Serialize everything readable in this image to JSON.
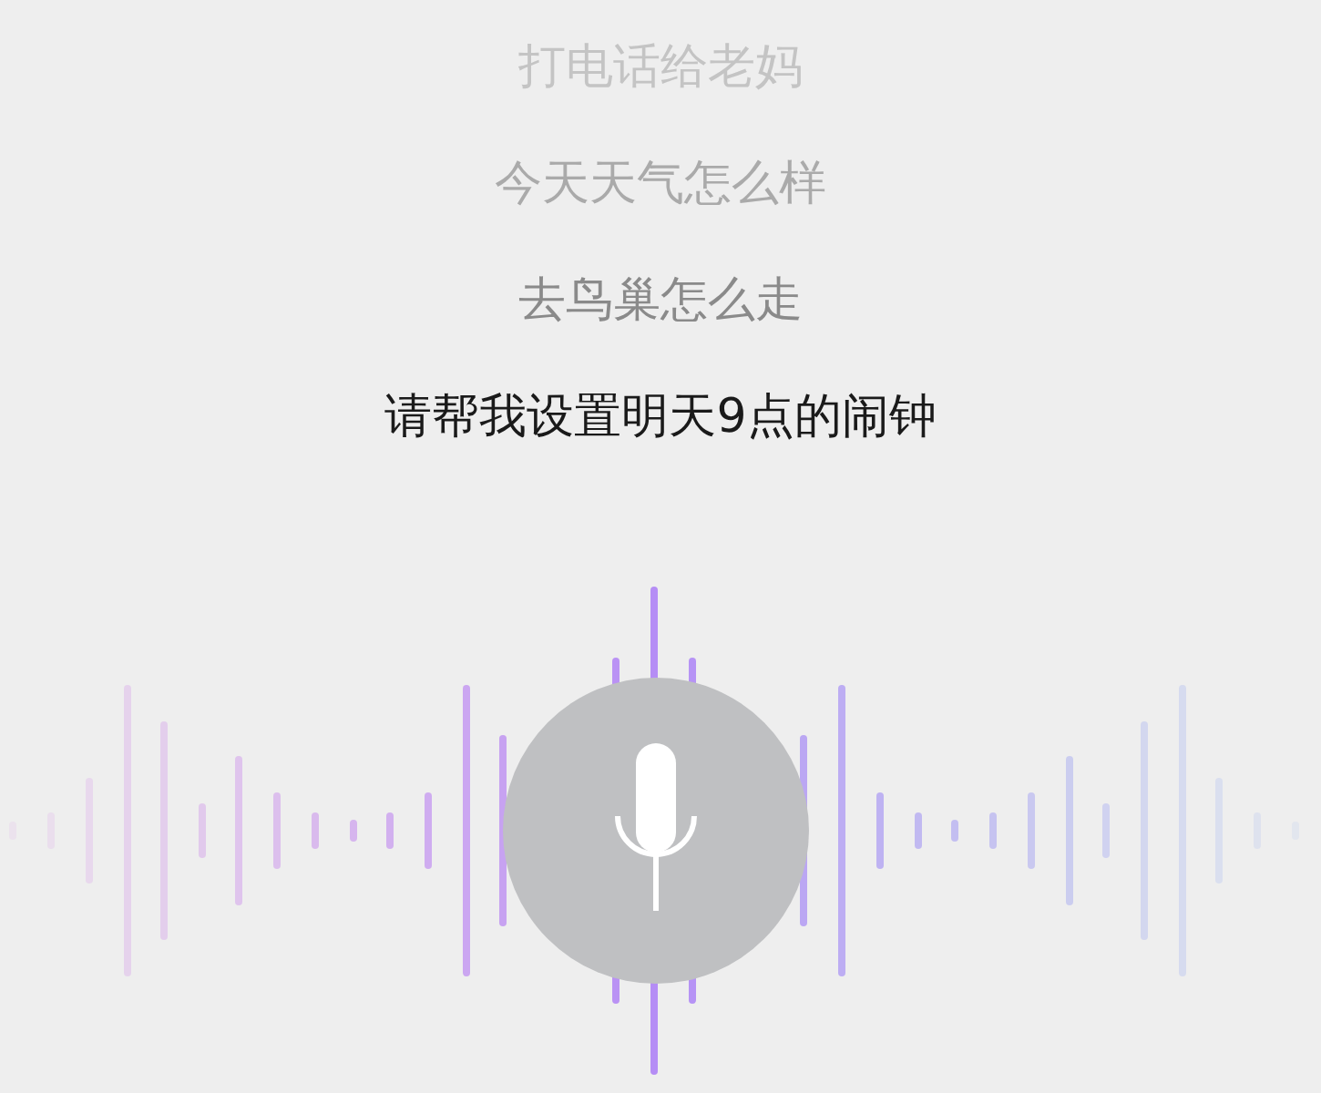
{
  "suggestions": [
    {
      "text": "打电话给老妈",
      "selected": false
    },
    {
      "text": "今天天气怎么样",
      "selected": false
    },
    {
      "text": "去鸟巢怎么走",
      "selected": false
    },
    {
      "text": "请帮我设置明天9点的闹钟",
      "selected": true
    }
  ]
}
